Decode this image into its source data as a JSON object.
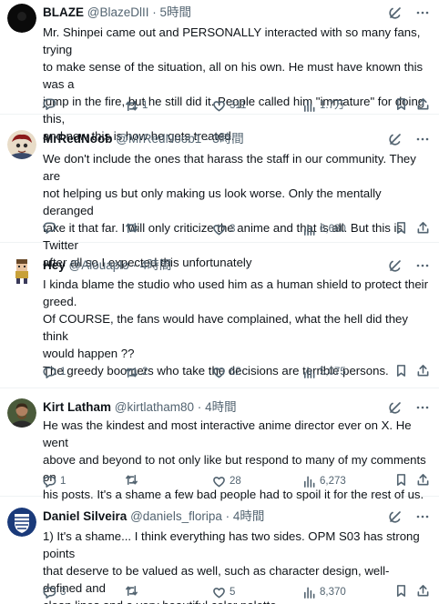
{
  "tweets": [
    {
      "name": "BLAZE",
      "handle": "@BlazeDlII",
      "time": "5時間",
      "text": "Mr. Shinpei came out and PERSONALLY interacted with so many fans, trying\nto make sense of the situation, all on his own. He must have known this was a\njump in the fire, but he still did it. People called him \"immature\" for doing this,\nand now this is how he gets treated.",
      "replies": "",
      "retweets": "1",
      "likes": "311",
      "views": "1.7万",
      "avatar_icon": "dark-avatar"
    },
    {
      "name": "MrRedNoob",
      "handle": "@MrRedNoob1",
      "time": "3時間",
      "text": "We don't include the ones that harass the staff in our community. They are\nnot helping us but only making us look worse. Only the mentally deranged\ntake it that far. I will only criticize the anime and that is all. But this is Twitter\nafter all so I expected this unfortunately",
      "replies": "",
      "retweets": "",
      "likes": "3",
      "views": "6,680",
      "avatar_icon": "anime-character-avatar"
    },
    {
      "name": "Hey",
      "handle": "@Alouaplo",
      "time": "4時間",
      "text": "I kinda blame the studio who used him as a human shield to protect their\ngreed.\nOf COURSE, the fans would have complained, what the hell did they think\nwould happen ??\nThe greedy boomers who take the decisions are terrible persons.",
      "replies": "1",
      "retweets": "2",
      "likes": "62",
      "views": "5,075",
      "avatar_icon": "pixel-character-avatar"
    },
    {
      "name": "Kirt Latham",
      "handle": "@kirtlatham80",
      "time": "4時間",
      "text": "He was the kindest and most interactive anime director ever on X. He went\nabove and beyond to not only like but respond to many of my comments on\nhis posts. It's a shame a few bad people had to spoil it for the rest of us.",
      "replies": "1",
      "retweets": "",
      "likes": "28",
      "views": "6,273",
      "avatar_icon": "photo-avatar"
    },
    {
      "name": "Daniel Silveira",
      "handle": "@daniels_floripa",
      "time": "4時間",
      "text": "1) It's a shame... I think everything has two sides. OPM S03 has strong points\nthat deserve to be valued as well, such as character design, well-defined and\nclean lines and a very beautiful color palette.",
      "replies": "3",
      "retweets": "",
      "likes": "5",
      "views": "8,370",
      "avatar_icon": "crest-avatar"
    }
  ],
  "header_icons": [
    "grok-icon",
    "more-icon"
  ],
  "separator": "·"
}
